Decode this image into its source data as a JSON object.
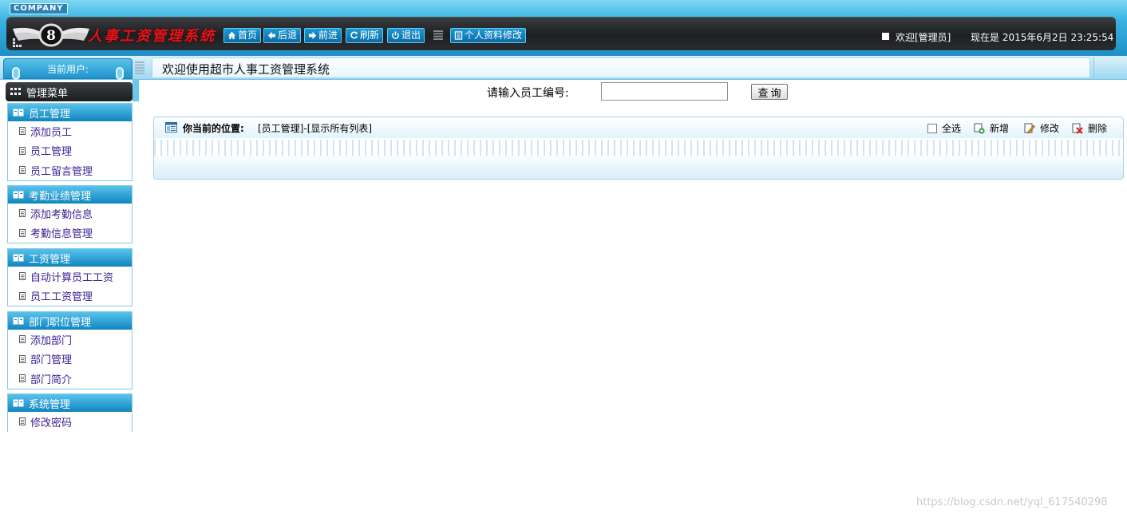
{
  "header": {
    "company_tag": "COMPANY",
    "system_title": "人事工资管理系统",
    "nav": [
      {
        "label": "首页",
        "icon": "home-icon"
      },
      {
        "label": "后退",
        "icon": "arrow-left-icon"
      },
      {
        "label": "前进",
        "icon": "arrow-right-icon"
      },
      {
        "label": "刷新",
        "icon": "refresh-icon"
      },
      {
        "label": "退出",
        "icon": "power-icon"
      }
    ],
    "profile_button": "个人资料修改",
    "welcome": "欢迎[管理员]",
    "datetime": "现在是 2015年6月2日 23:25:54"
  },
  "subbar": {
    "current_user_label": "当前用户:",
    "welcome_banner": "欢迎使用超市人事工资管理系统"
  },
  "sidebar": {
    "menu_title": "管理菜单",
    "groups": [
      {
        "title": "员工管理",
        "items": [
          "添加员工",
          "员工管理",
          "员工留言管理"
        ]
      },
      {
        "title": "考勤业绩管理",
        "items": [
          "添加考勤信息",
          "考勤信息管理"
        ]
      },
      {
        "title": "工资管理",
        "items": [
          "自动计算员工工资",
          "员工工资管理"
        ]
      },
      {
        "title": "部门职位管理",
        "items": [
          "添加部门",
          "部门管理",
          "部门简介"
        ]
      },
      {
        "title": "系统管理",
        "items": [
          "修改密码"
        ]
      }
    ]
  },
  "search": {
    "label": "请输入员工编号:",
    "value": "",
    "button": "查询"
  },
  "list": {
    "position_title": "你当前的位置:",
    "position_path": "[员工管理]-[显示所有列表]",
    "actions": {
      "select_all": "全选",
      "add": "新增",
      "edit": "修改",
      "delete": "删除"
    }
  },
  "watermark": "https://blog.csdn.net/yql_617540298",
  "colors": {
    "accent": "#1f8fc4",
    "dark_bar": "#1d1f22",
    "title_red": "#e0151b",
    "menu_link": "#3b1f93"
  }
}
